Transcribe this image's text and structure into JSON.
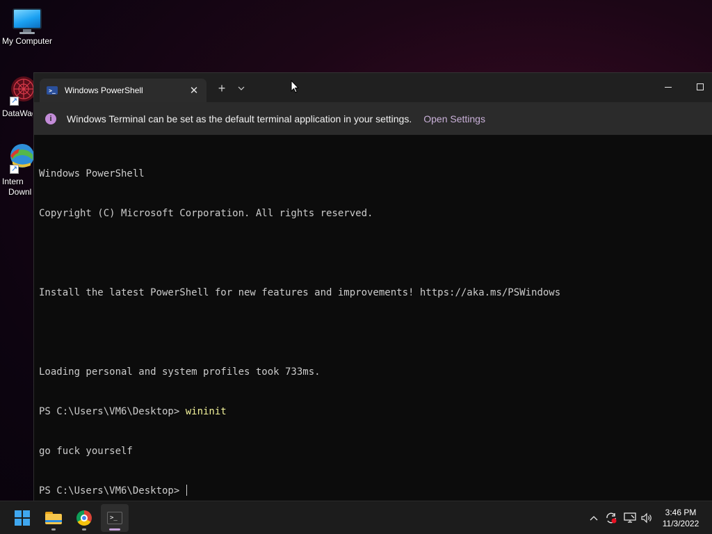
{
  "desktop": {
    "icons": [
      {
        "label": "My Computer",
        "icon": "computer-icon"
      },
      {
        "label": "DataWag",
        "icon": "datawag-icon"
      },
      {
        "label": "Intern",
        "label2": "Downl",
        "icon": "internet-download-icon"
      }
    ]
  },
  "window": {
    "tab_title": "Windows PowerShell",
    "tab_icon": "powershell-icon",
    "new_tab_glyph": "+",
    "dropdown_glyph": "⌄",
    "close_glyph": "✕"
  },
  "infobar": {
    "message": "Windows Terminal can be set as the default terminal application in your settings.",
    "link": "Open Settings",
    "icon_glyph": "i"
  },
  "console": {
    "lines": [
      "Windows PowerShell",
      "Copyright (C) Microsoft Corporation. All rights reserved.",
      "",
      "Install the latest PowerShell for new features and improvements! https://aka.ms/PSWindows",
      "",
      "Loading personal and system profiles took 733ms."
    ],
    "prompt": "PS C:\\Users\\VM6\\Desktop> ",
    "command": "wininit",
    "output": "go fuck yourself",
    "prompt2": "PS C:\\Users\\VM6\\Desktop> "
  },
  "taskbar": {
    "apps": [
      "start-button",
      "file-explorer",
      "chrome",
      "terminal"
    ],
    "tray_icons": [
      "chevron-up-icon",
      "sync-icon",
      "network-icon",
      "volume-icon"
    ],
    "time": "3:46 PM",
    "date": "11/3/2022"
  },
  "colors": {
    "accent": "#c6a1dc",
    "console_bg": "#0c0c0c",
    "command_text": "#f2f29a"
  }
}
